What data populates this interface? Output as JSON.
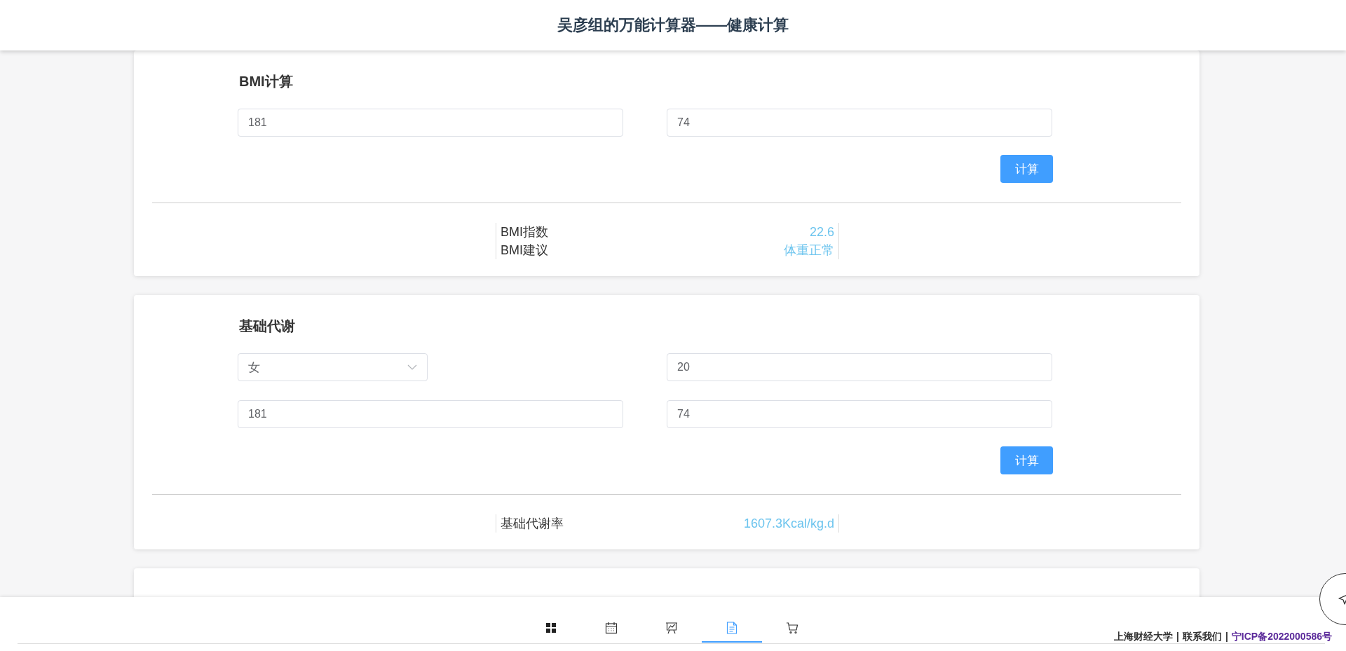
{
  "header": {
    "title": "吴彦组的万能计算器——健康计算"
  },
  "cards": [
    {
      "title": "BMI计算",
      "fields": [
        {
          "kind": "input",
          "value": "181"
        },
        {
          "kind": "input",
          "value": "74"
        }
      ],
      "button": "计算",
      "results": [
        {
          "label": "BMI指数",
          "value": "22.6"
        },
        {
          "label": "BMI建议",
          "value": "体重正常"
        }
      ]
    },
    {
      "title": "基础代谢",
      "fields": [
        {
          "kind": "select",
          "value": "女"
        },
        {
          "kind": "input",
          "value": "20"
        },
        {
          "kind": "input",
          "value": "181"
        },
        {
          "kind": "input",
          "value": "74"
        }
      ],
      "button": "计算",
      "results": [
        {
          "label": "基础代谢率",
          "value": "1607.3Kcal/kg.d"
        }
      ]
    }
  ],
  "tabs": [
    {
      "kind": "grid",
      "selected": false
    },
    {
      "kind": "calendar",
      "selected": false
    },
    {
      "kind": "chart",
      "selected": false
    },
    {
      "kind": "document",
      "selected": true
    },
    {
      "kind": "cart",
      "selected": false
    }
  ],
  "footer": {
    "school": "上海财经大学",
    "separators": [
      "|",
      "|"
    ],
    "contact": "联系我们",
    "icp": "宁ICP备2022000586号"
  }
}
